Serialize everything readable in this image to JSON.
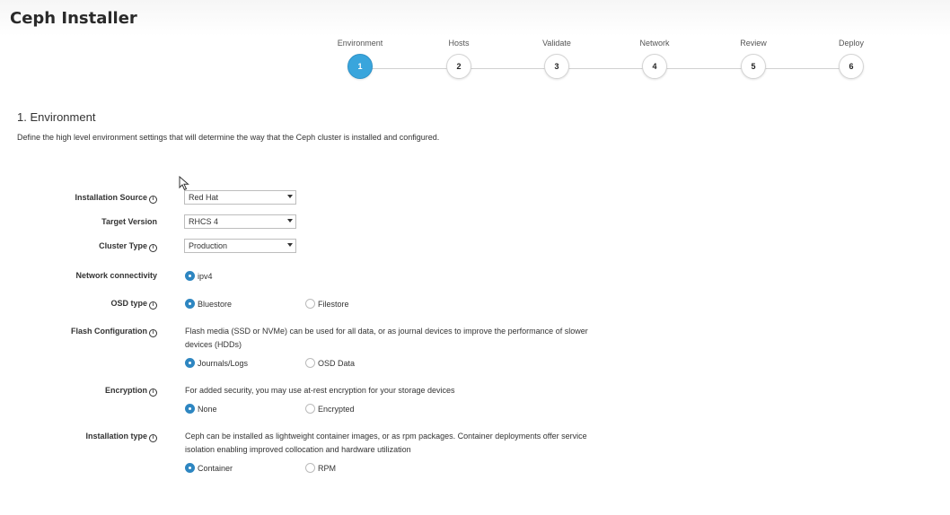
{
  "app": {
    "title": "Ceph Installer"
  },
  "stepper": {
    "steps": [
      {
        "label": "Environment",
        "number": "1",
        "active": true
      },
      {
        "label": "Hosts",
        "number": "2",
        "active": false
      },
      {
        "label": "Validate",
        "number": "3",
        "active": false
      },
      {
        "label": "Network",
        "number": "4",
        "active": false
      },
      {
        "label": "Review",
        "number": "5",
        "active": false
      },
      {
        "label": "Deploy",
        "number": "6",
        "active": false
      }
    ]
  },
  "section": {
    "title": "1. Environment",
    "description": "Define the high level environment settings that will determine the way that the Ceph cluster is installed and configured."
  },
  "form": {
    "installation_source": {
      "label": "Installation Source",
      "value": "Red Hat"
    },
    "target_version": {
      "label": "Target Version",
      "value": "RHCS 4"
    },
    "cluster_type": {
      "label": "Cluster Type",
      "value": "Production"
    },
    "network_connectivity": {
      "label": "Network connectivity",
      "option1": "ipv4"
    },
    "osd_type": {
      "label": "OSD type",
      "option1": "Bluestore",
      "option2": "Filestore"
    },
    "flash_configuration": {
      "label": "Flash Configuration",
      "help": "Flash media (SSD or NVMe) can be used for all data, or as journal devices to improve the performance of slower devices (HDDs)",
      "option1": "Journals/Logs",
      "option2": "OSD Data"
    },
    "encryption": {
      "label": "Encryption",
      "help": "For added security, you may use at-rest encryption for your storage devices",
      "option1": "None",
      "option2": "Encrypted"
    },
    "installation_type": {
      "label": "Installation type",
      "help": "Ceph can be installed as lightweight container images, or as rpm packages. Container deployments offer service isolation enabling improved collocation and hardware utilization",
      "option1": "Container",
      "option2": "RPM"
    }
  },
  "icons": {
    "info": "info-icon",
    "cursor": "mouse-pointer-icon",
    "radio": "radio-button-icon"
  },
  "colors": {
    "accent": "#39a5dc",
    "radio_checked": "#2e86c1"
  }
}
